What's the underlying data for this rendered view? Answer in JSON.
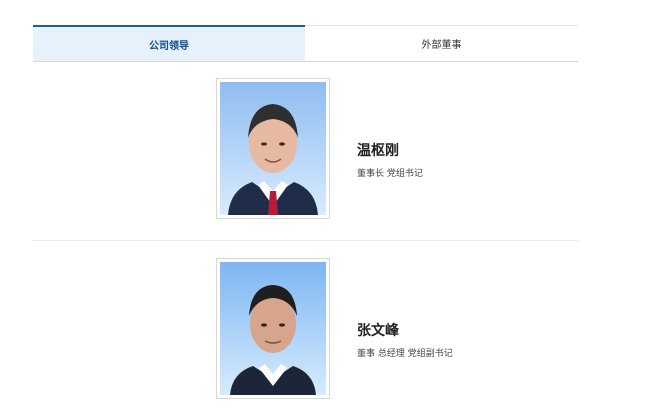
{
  "tabs": [
    {
      "label": "公司领导",
      "active": true
    },
    {
      "label": "外部董事",
      "active": false
    }
  ],
  "people": [
    {
      "name": "温枢刚",
      "title": "董事长 党组书记",
      "bg_top": "#8fbdf0",
      "bg_bottom": "#d8ebff"
    },
    {
      "name": "张文峰",
      "title": "董事 总经理 党组副书记",
      "bg_top": "#7db6f1",
      "bg_bottom": "#d7ebff"
    }
  ],
  "colors": {
    "tab_active_bg": "#e6f1fb",
    "tab_active_text": "#0f4f8a",
    "accent": "#1f5f95"
  }
}
